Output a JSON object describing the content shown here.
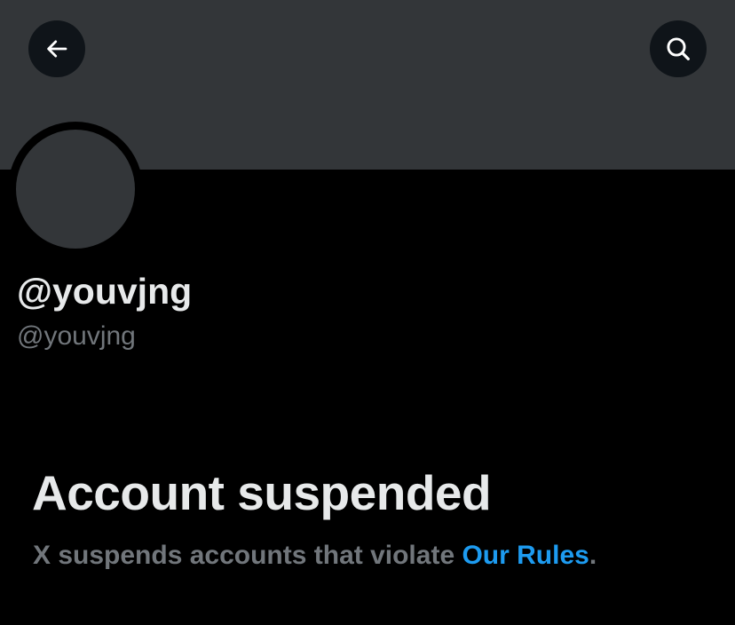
{
  "header": {
    "back_icon": "arrow-left-icon",
    "search_icon": "search-icon"
  },
  "profile": {
    "display_name": "@youvjng",
    "handle": "@youvjng"
  },
  "suspension": {
    "title": "Account suspended",
    "message_prefix": "X suspends accounts that violate ",
    "rules_link": "Our Rules",
    "message_suffix": "."
  },
  "colors": {
    "background": "#000000",
    "banner": "#333639",
    "primary_text": "#e7e9ea",
    "secondary_text": "#71767b",
    "link": "#1d9bf0"
  }
}
